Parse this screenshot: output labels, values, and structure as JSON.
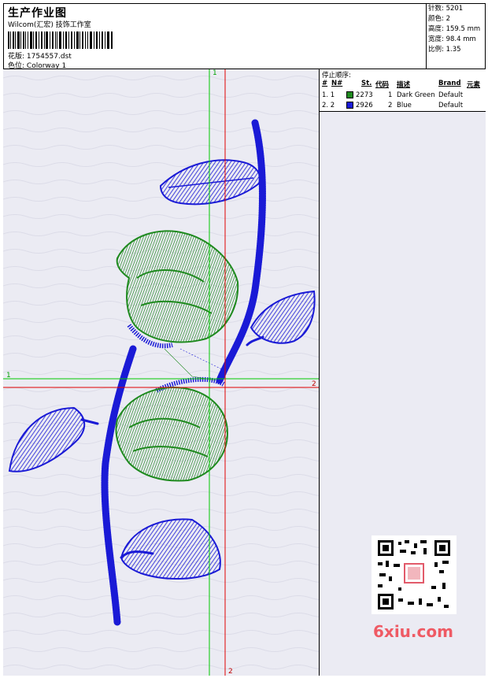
{
  "header": {
    "title": "生产作业图",
    "subtitle": "Wilcom(汇宏) 技饰工作室",
    "design_label": "花版:",
    "design_value": "1754557.dst",
    "colorway_label": "色位:",
    "colorway_value": "Colorway 1"
  },
  "stats": {
    "stitches_label": "针数:",
    "stitches_value": "5201",
    "colors_label": "颜色:",
    "colors_value": "2",
    "height_label": "高度:",
    "height_value": "159.5 mm",
    "width_label": "宽度:",
    "width_value": "98.4 mm",
    "scale_label": "比例:",
    "scale_value": "1.35"
  },
  "stop_sequence": {
    "title": "停止顺序:",
    "headers": {
      "hash": "#",
      "no": "N#",
      "st": "St.",
      "code": "代码",
      "desc": "描述",
      "brand": "Brand",
      "elem": "元素"
    },
    "rows": [
      {
        "idx": "1. 1",
        "color": "#1f8a1f",
        "st": "2273",
        "code": "1",
        "desc": "Dark Green",
        "brand": "Default"
      },
      {
        "idx": "2. 2",
        "color": "#1a1ad6",
        "st": "2926",
        "code": "2",
        "desc": "Blue",
        "brand": "Default"
      }
    ]
  },
  "axes": {
    "green_top": "1",
    "green_left": "1",
    "red_right": "2",
    "red_bottom": "2"
  },
  "watermark": {
    "text": "6xiu.com"
  },
  "colors": {
    "green_thread": "#1f8a1f",
    "blue_thread": "#1a1ad6",
    "axis_green": "#00c800",
    "axis_red": "#e00000"
  }
}
